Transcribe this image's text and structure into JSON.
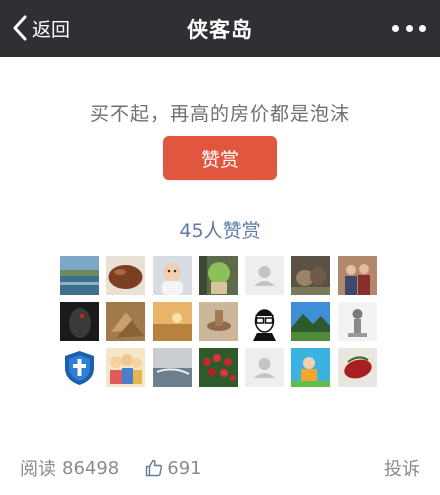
{
  "header": {
    "back_label": "返回",
    "title": "侠客岛",
    "back_icon": "chevron-left-icon",
    "more_icon": "more-dots-icon"
  },
  "slogan": "买不起，再高的房价都是泡沫",
  "reward_button": {
    "label": "赞赏",
    "color": "#e0563e"
  },
  "reward_count": "45人赞赏",
  "avatars": [
    {
      "name": "avatar-lake-landscape"
    },
    {
      "name": "avatar-brown-stone"
    },
    {
      "name": "avatar-baby-photo"
    },
    {
      "name": "avatar-cactus"
    },
    {
      "name": "avatar-default-placeholder"
    },
    {
      "name": "avatar-dogs-outdoors"
    },
    {
      "name": "avatar-two-people"
    },
    {
      "name": "avatar-computer-mouse"
    },
    {
      "name": "avatar-dry-leaves"
    },
    {
      "name": "avatar-desert-sunset"
    },
    {
      "name": "avatar-sandy-ground"
    },
    {
      "name": "avatar-cartoon-glasses-man"
    },
    {
      "name": "avatar-mountain-field"
    },
    {
      "name": "avatar-stone-sculpture"
    },
    {
      "name": "avatar-blue-shield-cross"
    },
    {
      "name": "avatar-cartoon-group"
    },
    {
      "name": "avatar-seascape"
    },
    {
      "name": "avatar-red-flowers"
    },
    {
      "name": "avatar-default-placeholder"
    },
    {
      "name": "avatar-child-playing"
    },
    {
      "name": "avatar-red-bean"
    }
  ],
  "footer": {
    "reads_label": "阅读",
    "reads_count": "86498",
    "likes_count": "691",
    "like_icon": "thumbs-up-icon",
    "report_label": "投诉"
  },
  "colors": {
    "topbar": "#2f3033",
    "link_blue": "#5e7ba2",
    "muted_text": "#8a8a8a"
  }
}
